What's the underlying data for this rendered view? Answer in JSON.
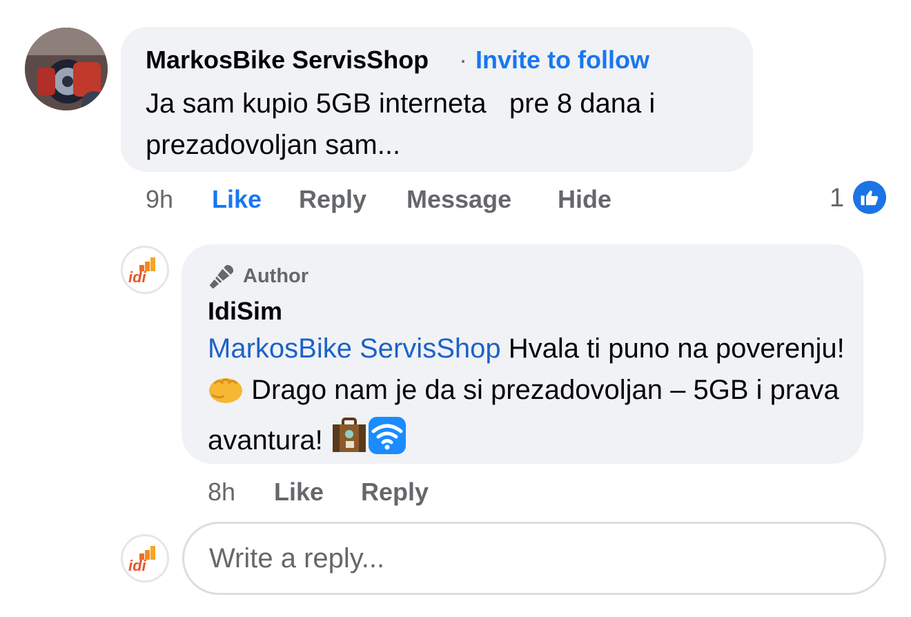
{
  "comment": {
    "author": "MarkosBike ServisShop",
    "separator": "·",
    "invite_label": "Invite to follow",
    "text": "Ja sam kupio 5GB interneta   pre 8 dana i prezadovoljan sam...",
    "time": "9h",
    "actions": {
      "like": "Like",
      "reply": "Reply",
      "message": "Message",
      "hide": "Hide"
    },
    "reaction_count": "1",
    "liked": true,
    "colors": {
      "liked": "#1877f2",
      "bubble": "#f0f2f5",
      "muted": "#65676b"
    }
  },
  "reply": {
    "badge": "Author",
    "author": "IdiSim",
    "mention": "MarkosBike ServisShop",
    "text_part1": " Hvala ti puno na poverenju! ",
    "text_part2": " Drago nam je da si prezadovoljan – 5GB i prava avantura! ",
    "emojis": [
      "fist-emoji",
      "suitcase-emoji",
      "wifi-emoji"
    ],
    "time": "8h",
    "actions": {
      "like": "Like",
      "reply": "Reply"
    },
    "colors": {
      "mention": "#1d61c9"
    }
  },
  "composer": {
    "placeholder": "Write a reply..."
  },
  "brand": {
    "logo_text": "idi",
    "logo_colors": [
      "#f5a623",
      "#e8542a"
    ]
  }
}
